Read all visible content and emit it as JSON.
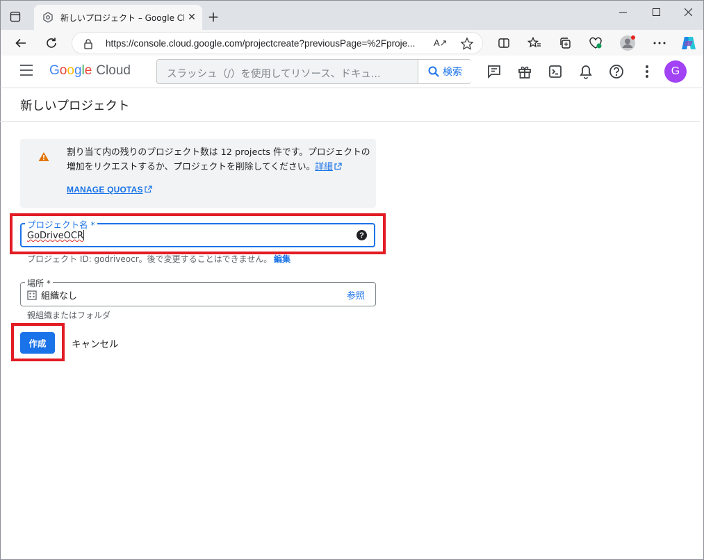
{
  "browser": {
    "tab_title": "新しいプロジェクト – Google Cloud コンソール",
    "url_host": "console.cloud.google.com",
    "url_prefix": "https://",
    "url_path": "/projectcreate?previousPage=%2Fproje...",
    "read_aloud": "A↗"
  },
  "header": {
    "logo_google": [
      "G",
      "o",
      "o",
      "g",
      "l",
      "e"
    ],
    "logo_cloud": "Cloud",
    "search_placeholder": "スラッシュ（/）を使用してリソース、ドキュ...",
    "search_button": "検索",
    "avatar_letter": "G"
  },
  "page": {
    "title": "新しいプロジェクト",
    "quota_message": "割り当て内の残りのプロジェクト数は 12 projects 件です。プロジェクトの増加をリクエストするか、プロジェクトを削除してください。",
    "quota_link": "詳細",
    "manage_quotas": "MANAGE QUOTAS",
    "project_name_label": "プロジェクト名 *",
    "project_name_value": "GoDriveOCR",
    "project_id_text": "プロジェクト ID: godriveocr。後で変更することはできません。",
    "project_id_edit": "編集",
    "location_label": "場所 *",
    "location_value": "組織なし",
    "location_browse": "参照",
    "location_hint": "親組織またはフォルダ",
    "create_button": "作成",
    "cancel_button": "キャンセル"
  },
  "colors": {
    "accent": "#1a73e8",
    "highlight": "#e21c24",
    "warning": "#e37400",
    "avatar": "#a142f4"
  }
}
